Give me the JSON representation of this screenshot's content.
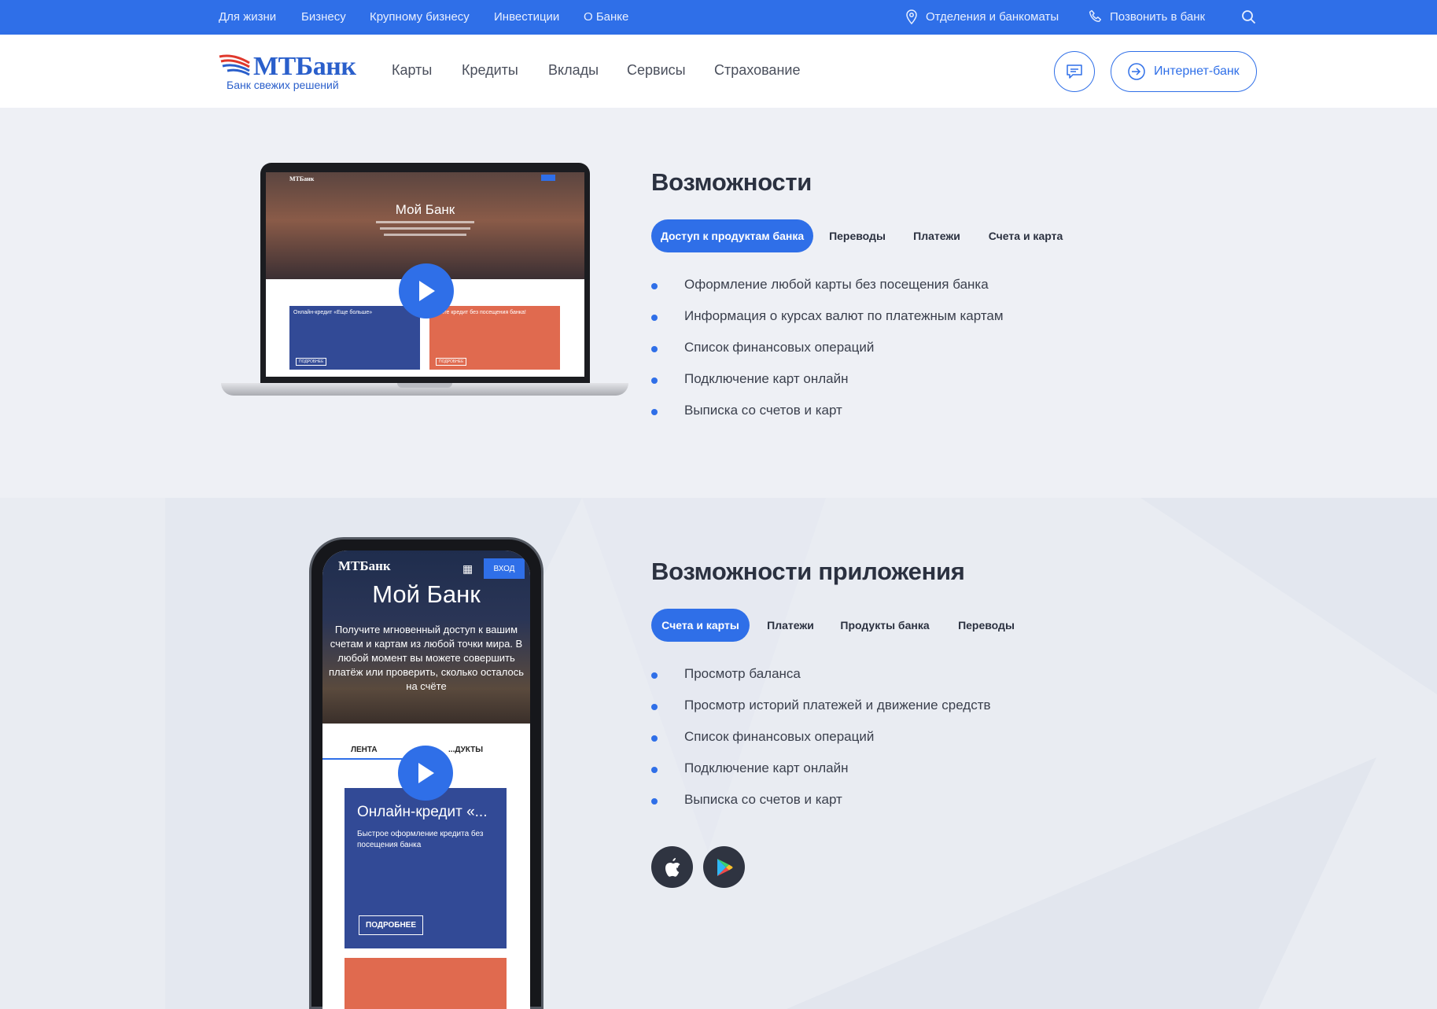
{
  "colors": {
    "accent": "#2f6fe8",
    "topbar": "#2f6fe8",
    "dark": "#2b3140"
  },
  "topbar": {
    "links": [
      "Для жизни",
      "Бизнесу",
      "Крупному бизнесу",
      "Инвестиции",
      "О Банке"
    ],
    "branches": "Отделения и банкоматы",
    "call": "Позвонить в банк"
  },
  "header": {
    "logo": "МТБанк",
    "slogan": "Банк свежих решений",
    "nav": [
      "Карты",
      "Кредиты",
      "Вклады",
      "Сервисы",
      "Страхование"
    ],
    "internet_bank": "Интернет-банк"
  },
  "section1": {
    "title": "Возможности",
    "tabs": [
      "Доступ к продуктам банка",
      "Переводы",
      "Платежи",
      "Счета и карта"
    ],
    "active_tab": "Доступ к продуктам банка",
    "items": [
      "Оформление любой карты без посещения банка",
      "Информация о курсах валют по платежным картам",
      "Список финансовых операций",
      "Подключение карт онлайн",
      "Выписка со счетов и карт"
    ],
    "laptop": {
      "logo": "МТБанк",
      "hero_title": "Мой Банк",
      "card1_title": "Онлайн-кредит «Еще больше»",
      "card2_title": "...чите кредит без посещения банка!",
      "card_button": "ПОДРОБНЕЕ"
    }
  },
  "section2": {
    "title": "Возможности приложения",
    "tabs": [
      "Счета и карты",
      "Платежи",
      "Продукты банка",
      "Переводы"
    ],
    "active_tab": "Счета и карты",
    "items": [
      "Просмотр баланса",
      "Просмотр историй платежей и движение средств",
      "Список финансовых операций",
      "Подключение карт онлайн",
      "Выписка со счетов и карт"
    ],
    "phone": {
      "logo": "МТБанк",
      "login": "ВХОД",
      "hero_title": "Мой Банк",
      "hero_text": "Получите мгновенный доступ к вашим счетам и картам из любой точки мира. В любой момент вы можете совершить платёж или проверить, сколько осталось на счёте",
      "tab_feed": "ЛЕНТА",
      "tab_products": "...ДУКТЫ",
      "card_title": "Онлайн-кредит «...",
      "card_text": "Быстрое оформление кредита без посещения банка",
      "card_button": "ПОДРОБНЕЕ"
    },
    "stores": [
      "apple-icon",
      "google-play-icon"
    ]
  }
}
